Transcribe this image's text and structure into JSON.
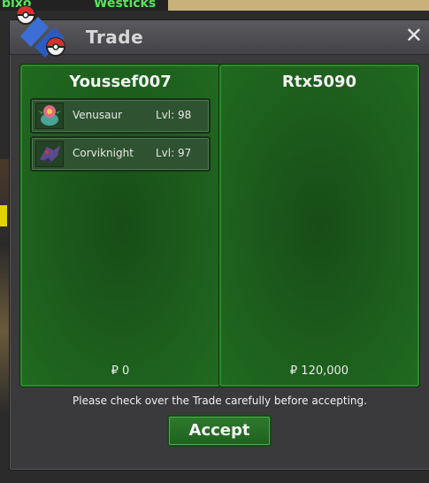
{
  "background": {
    "nameplate_left": "bixo",
    "nameplate_right": "Westicks"
  },
  "window": {
    "title": "Trade",
    "close_glyph": "✕"
  },
  "left_panel": {
    "player_name": "Youssef007",
    "money": "₽ 0",
    "items": [
      {
        "name": "Venusaur",
        "level": "Lvl: 98",
        "icon": "venusaur-icon"
      },
      {
        "name": "Corviknight",
        "level": "Lvl: 97",
        "icon": "corviknight-icon"
      }
    ]
  },
  "right_panel": {
    "player_name": "Rtx5090",
    "money": "₽ 120,000"
  },
  "notice": "Please check over the Trade carefully before accepting.",
  "accept_label": "Accept",
  "colors": {
    "panel_green": "#1d5e1d",
    "panel_border": "#2c8a2c",
    "window_bg": "#3a3a3c"
  }
}
